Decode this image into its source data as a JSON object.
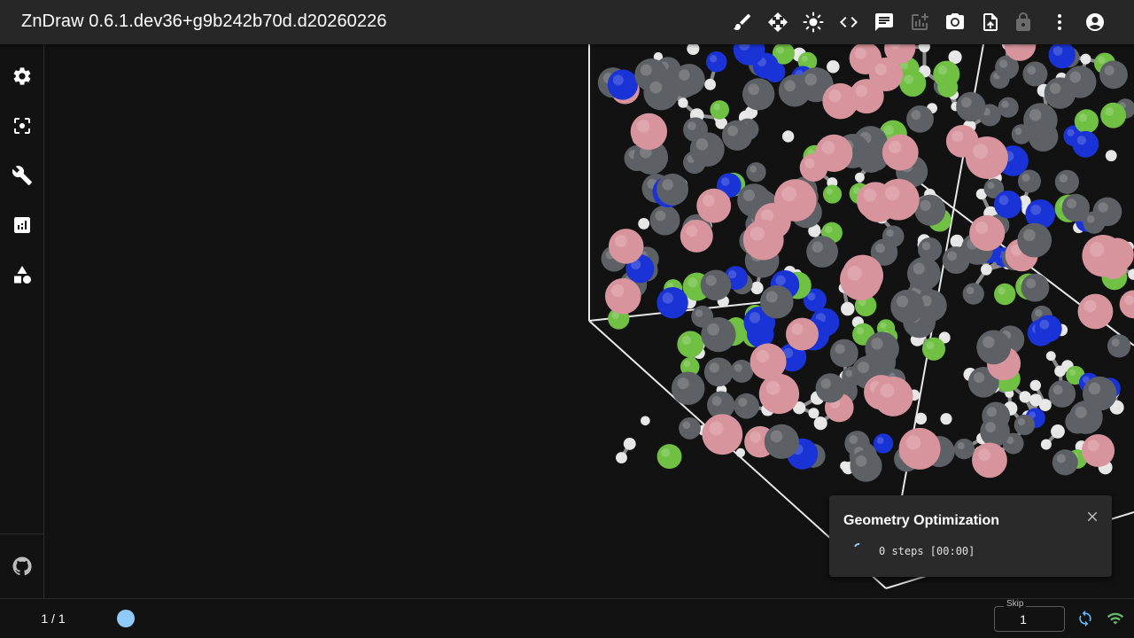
{
  "header": {
    "title": "ZnDraw 0.6.1.dev36+g9b242b70d.d20260226",
    "toolbar_icons": [
      "brush-icon",
      "move-icon",
      "brightness-icon",
      "code-icon",
      "chat-icon",
      "add-chart-icon",
      "camera-icon",
      "upload-icon",
      "lock-icon",
      "more-vert-icon",
      "account-icon"
    ]
  },
  "sidebar": {
    "items": [
      "settings-icon",
      "selection-icon",
      "wrench-icon",
      "analytics-icon",
      "geometry-icon"
    ],
    "footer_item": "github-icon"
  },
  "footer": {
    "frame_counter": "1 / 1",
    "skip_label": "Skip",
    "skip_value": "1",
    "icons": [
      "sync-icon",
      "wifi-icon"
    ]
  },
  "notification": {
    "title": "Geometry Optimization",
    "progress_text": "0 steps [00:00]"
  },
  "colors": {
    "header_bg": "#272727",
    "background": "#121212",
    "accent": "#90caf9",
    "carbon": "#5d6065",
    "hydrogen": "#e6e6e6",
    "nitrogen": "#1a33d6",
    "fluorine": "#6fc043",
    "boron": "#d8949c",
    "connected": "#66bb6a"
  }
}
